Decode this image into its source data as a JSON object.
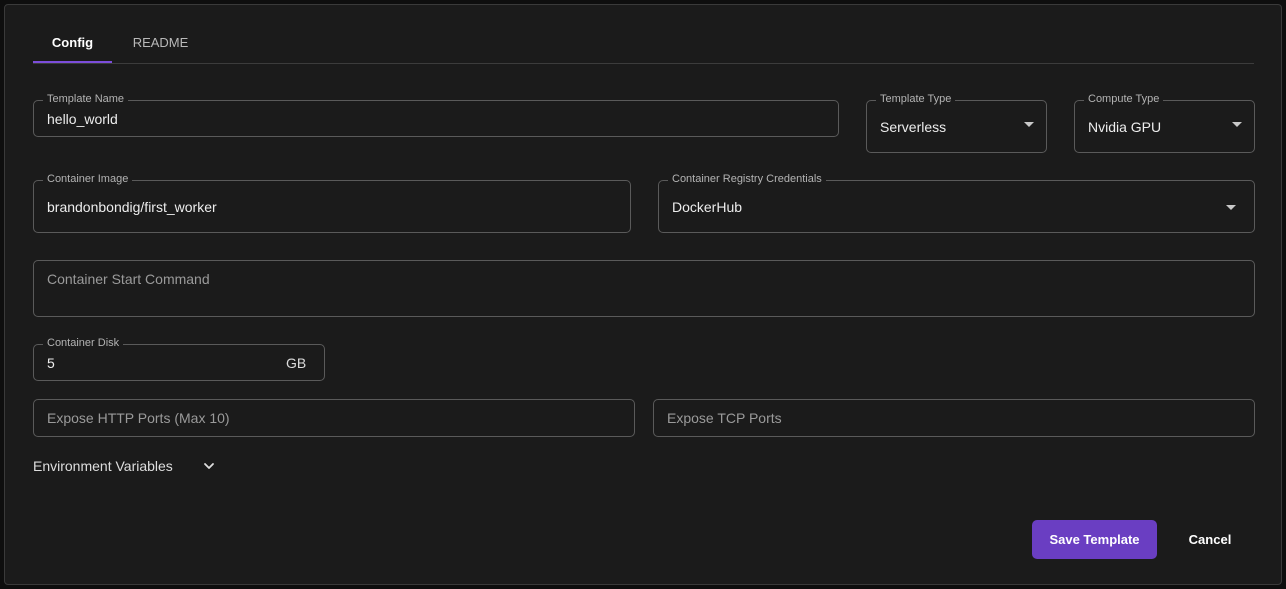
{
  "tabs": [
    {
      "label": "Config",
      "active": true
    },
    {
      "label": "README",
      "active": false
    }
  ],
  "form": {
    "template_name": {
      "label": "Template Name",
      "value": "hello_world"
    },
    "template_type": {
      "label": "Template Type",
      "value": "Serverless"
    },
    "compute_type": {
      "label": "Compute Type",
      "value": "Nvidia GPU"
    },
    "container_image": {
      "label": "Container Image",
      "value": "brandonbondig/first_worker"
    },
    "registry_credentials": {
      "label": "Container Registry Credentials",
      "value": "DockerHub"
    },
    "start_command": {
      "placeholder": "Container Start Command"
    },
    "container_disk": {
      "label": "Container Disk",
      "value": "5",
      "unit": "GB"
    },
    "http_ports": {
      "placeholder": "Expose HTTP Ports (Max 10)"
    },
    "tcp_ports": {
      "placeholder": "Expose TCP Ports"
    }
  },
  "env_vars": {
    "label": "Environment Variables"
  },
  "actions": {
    "save_label": "Save Template",
    "cancel_label": "Cancel"
  },
  "colors": {
    "accent": "#6a3ec2",
    "tab_indicator": "#7c4ddb",
    "background": "#1b1b1b"
  },
  "icons": {
    "dropdown": "caret-down-icon",
    "env_toggle": "chevron-down-icon"
  }
}
